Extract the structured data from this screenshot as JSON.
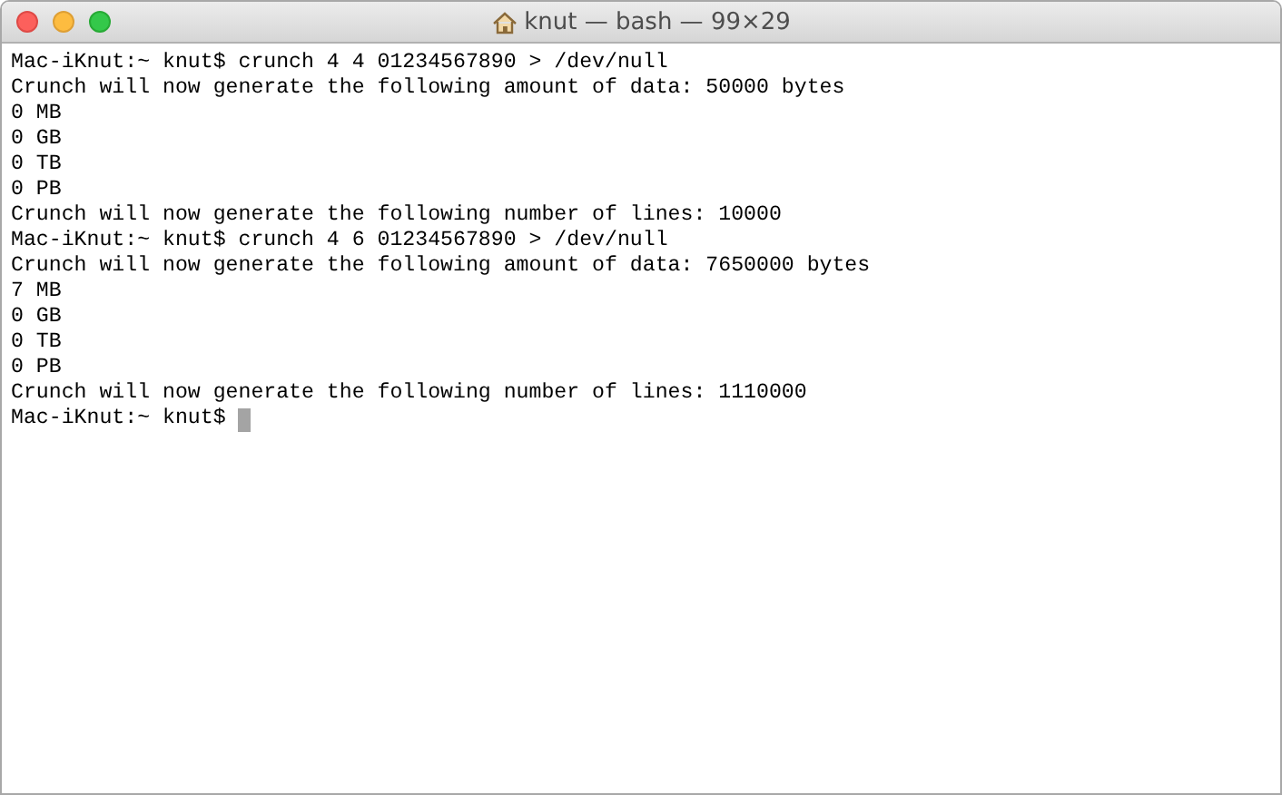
{
  "window": {
    "title": "knut — bash — 99×29"
  },
  "terminal": {
    "lines": [
      "Mac-iKnut:~ knut$ crunch 4 4 01234567890 > /dev/null",
      "Crunch will now generate the following amount of data: 50000 bytes",
      "0 MB",
      "0 GB",
      "0 TB",
      "0 PB",
      "Crunch will now generate the following number of lines: 10000",
      "Mac-iKnut:~ knut$ crunch 4 6 01234567890 > /dev/null",
      "Crunch will now generate the following amount of data: 7650000 bytes",
      "7 MB",
      "0 GB",
      "0 TB",
      "0 PB",
      "Crunch will now generate the following number of lines: 1110000"
    ],
    "prompt": "Mac-iKnut:~ knut$",
    "cursor_visible": true
  }
}
